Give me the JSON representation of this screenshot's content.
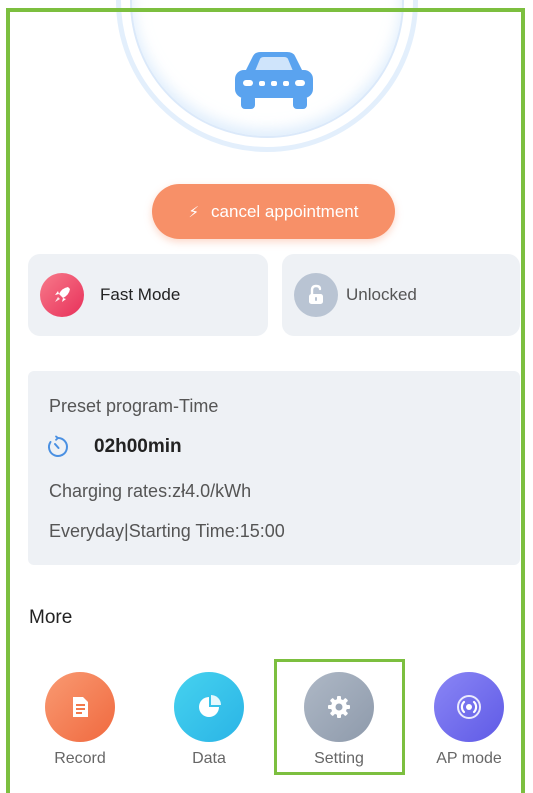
{
  "status": {
    "car_icon": "car-icon",
    "cancel_label": "cancel appointment"
  },
  "modes": {
    "fast_label": "Fast Mode",
    "lock_label": "Unlocked"
  },
  "preset": {
    "title": "Preset program-Time",
    "duration": "02h00min",
    "rate": "Charging rates:zł4.0/kWh",
    "schedule": "Everyday|Starting Time:15:00"
  },
  "more": {
    "title": "More",
    "items": [
      {
        "label": "Record",
        "icon": "record-icon"
      },
      {
        "label": "Data",
        "icon": "pie-chart-icon"
      },
      {
        "label": "Setting",
        "icon": "gear-icon"
      },
      {
        "label": "AP mode",
        "icon": "broadcast-icon"
      }
    ]
  },
  "colors": {
    "accent_orange": "#f79068",
    "highlight_green": "#7cbf3f",
    "card_bg": "#eef1f5",
    "car_blue": "#5aa3ef"
  }
}
